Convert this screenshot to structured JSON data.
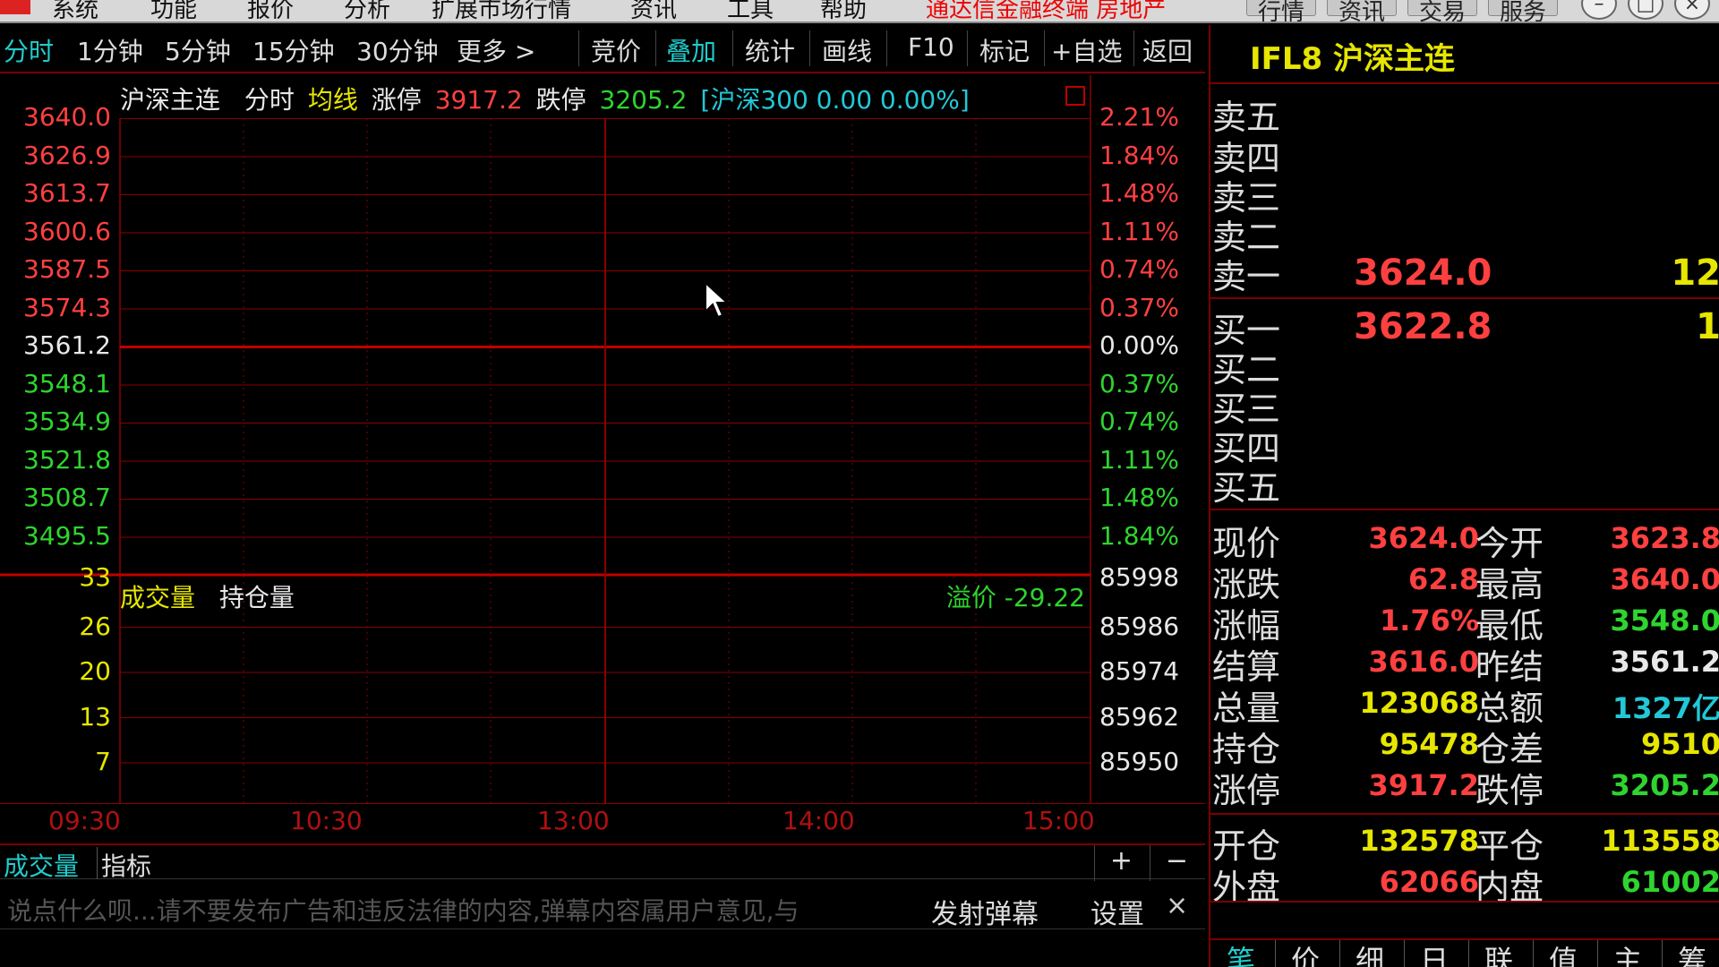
{
  "menu": {
    "items": [
      "系统",
      "功能",
      "报价",
      "分析",
      "扩展市场行情",
      "资讯",
      "工具",
      "帮助"
    ],
    "ad_text": "通达信金融终端 房地产",
    "right_buttons": [
      "行情",
      "资讯",
      "交易",
      "服务"
    ]
  },
  "toolbar": {
    "periods": [
      "分时",
      "1分钟",
      "5分钟",
      "15分钟",
      "30分钟",
      "更多 >"
    ],
    "tools": [
      "竞价",
      "叠加",
      "统计",
      "画线",
      "F10",
      "标记",
      "+自选",
      "返回"
    ],
    "active_period": "分时",
    "active_tool": "叠加"
  },
  "chart": {
    "info": {
      "name": "沪深主连",
      "mode": "分时",
      "avg_label": "均线",
      "limit_up_label": "涨停",
      "limit_up": "3917.2",
      "limit_down_label": "跌停",
      "limit_down": "3205.2",
      "overlay": "[沪深300 0.00 0.00%]"
    },
    "price_ticks": [
      "3640.0",
      "3626.9",
      "3613.7",
      "3600.6",
      "3587.5",
      "3574.3",
      "3561.2",
      "3548.1",
      "3534.9",
      "3521.8",
      "3508.7",
      "3495.5"
    ],
    "pct_ticks": [
      "2.21%",
      "1.84%",
      "1.48%",
      "1.11%",
      "0.74%",
      "0.37%",
      "0.00%",
      "0.37%",
      "0.74%",
      "1.11%",
      "1.48%",
      "1.84%"
    ],
    "volume_ticks": [
      "33",
      "26",
      "20",
      "13",
      "7"
    ],
    "oi_ticks": [
      "85998",
      "85986",
      "85974",
      "85962",
      "85950"
    ],
    "volume_label": "成交量",
    "oi_label": "持仓量",
    "premium": "溢价 -29.22",
    "time_ticks": [
      "09:30",
      "10:30",
      "13:00",
      "14:00",
      "15:00"
    ]
  },
  "bottom_tabs": [
    "成交量",
    "指标"
  ],
  "bottom_controls": {
    "plus": "+",
    "minus": "−"
  },
  "danmaku": {
    "placeholder": "说点什么呗...请不要发布广告和违反法律的内容,弹幕内容属用户意见,与",
    "send": "发射弹幕",
    "settings": "设置",
    "close": "×"
  },
  "quote": {
    "title": "IFL8 沪深主连",
    "sell_labels": [
      "卖五",
      "卖四",
      "卖三",
      "卖二",
      "卖一"
    ],
    "buy_labels": [
      "买一",
      "买二",
      "买三",
      "买四",
      "买五"
    ],
    "sell1_price": "3624.0",
    "sell1_vol": "12",
    "buy1_price": "3622.8",
    "buy1_vol": "1",
    "stats": [
      {
        "label": "现价",
        "value": "3624.0",
        "label2": "今开",
        "value2": "3623.8"
      },
      {
        "label": "涨跌",
        "value": "62.8",
        "label2": "最高",
        "value2": "3640.0"
      },
      {
        "label": "涨幅",
        "value": "1.76%",
        "label2": "最低",
        "value2": "3548.0"
      },
      {
        "label": "结算",
        "value": "3616.0",
        "label2": "昨结",
        "value2": "3561.2"
      },
      {
        "label": "总量",
        "value": "123068",
        "label2": "总额",
        "value2": "1327亿"
      },
      {
        "label": "持仓",
        "value": "95478",
        "label2": "仓差",
        "value2": "9510"
      },
      {
        "label": "涨停",
        "value": "3917.2",
        "label2": "跌停",
        "value2": "3205.2"
      }
    ],
    "stats2": [
      {
        "label": "开仓",
        "value": "132578",
        "label2": "平仓",
        "value2": "113558"
      },
      {
        "label": "外盘",
        "value": "62066",
        "label2": "内盘",
        "value2": "61002"
      }
    ],
    "tabs": [
      "笔",
      "价",
      "细",
      "日",
      "联",
      "值",
      "主",
      "筹"
    ]
  },
  "colors": {
    "up": "#ff4040",
    "down": "#2fd42f",
    "flat": "#e8e8e8",
    "volume": "#e6e600",
    "amount": "#22c8d8",
    "grid": "#8a0000",
    "active": "#22c8c8"
  }
}
